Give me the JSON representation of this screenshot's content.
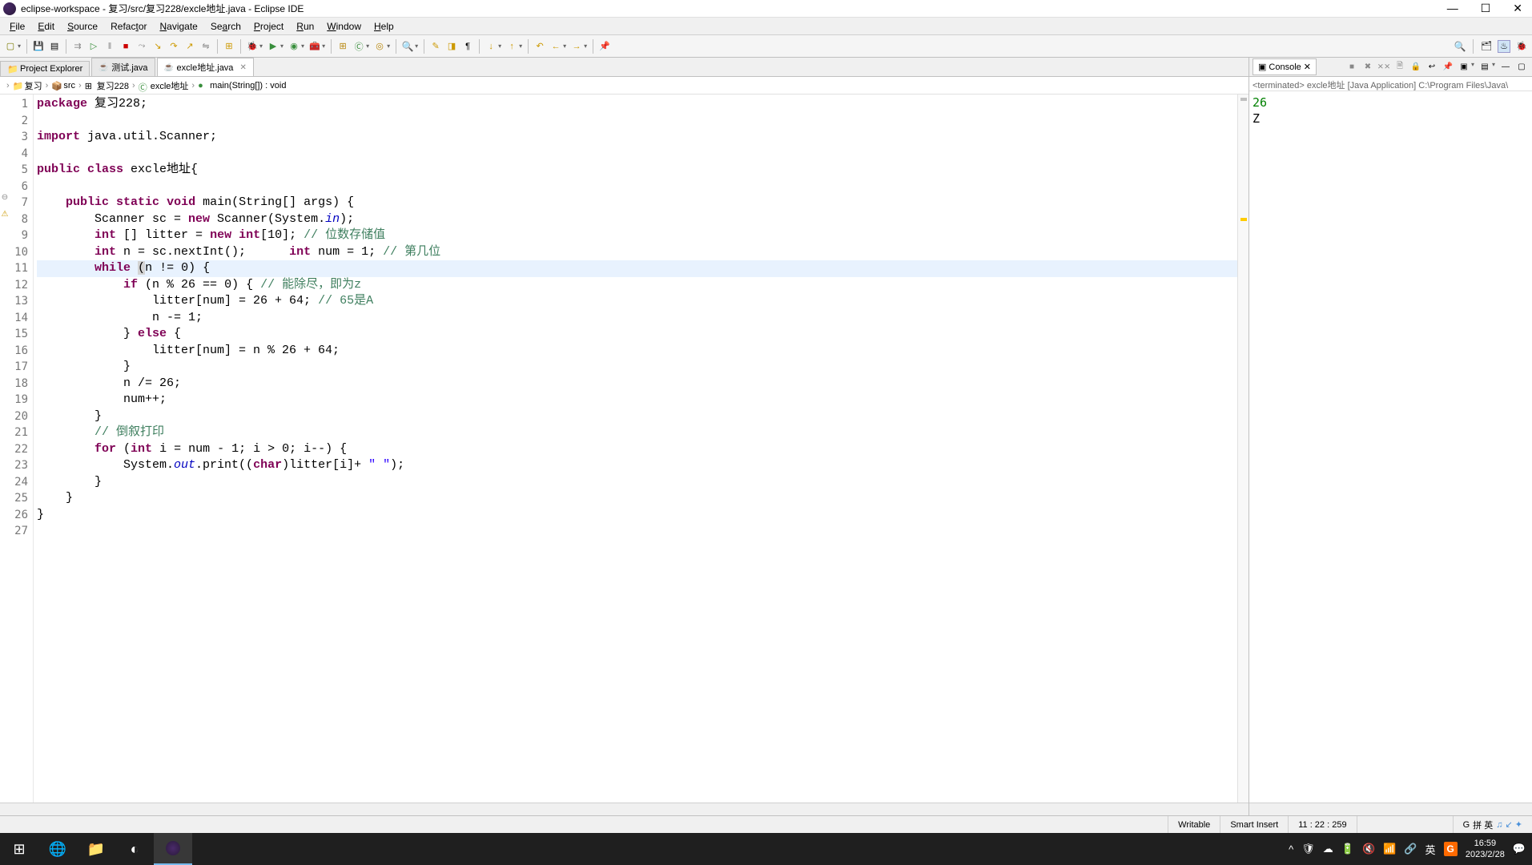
{
  "window": {
    "title": "eclipse-workspace - 复习/src/复习228/excle地址.java - Eclipse IDE"
  },
  "menu": [
    "File",
    "Edit",
    "Source",
    "Refactor",
    "Navigate",
    "Search",
    "Project",
    "Run",
    "Window",
    "Help"
  ],
  "tabs": {
    "project_explorer": "Project Explorer",
    "file1": "测试.java",
    "file2": "excle地址.java"
  },
  "breadcrumb": [
    "复习",
    "src",
    "复习228",
    "excle地址",
    "main(String[]) : void"
  ],
  "code": {
    "lines": [
      {
        "n": "1",
        "html": "<span class='kw'>package</span> 复习228;"
      },
      {
        "n": "2",
        "html": ""
      },
      {
        "n": "3",
        "html": "<span class='kw'>import</span> java.util.Scanner;"
      },
      {
        "n": "4",
        "html": ""
      },
      {
        "n": "5",
        "html": "<span class='kw'>public</span> <span class='kw'>class</span> excle地址{"
      },
      {
        "n": "6",
        "html": ""
      },
      {
        "n": "7",
        "marker": "⊖",
        "html": "    <span class='kw'>public</span> <span class='kw'>static</span> <span class='kw'>void</span> main(String[] args) {"
      },
      {
        "n": "8",
        "warn": true,
        "html": "        Scanner sc = <span class='kw'>new</span> Scanner(System.<span class='fld'>in</span>);"
      },
      {
        "n": "9",
        "html": "        <span class='kw'>int</span> [] litter = <span class='kw'>new</span> <span class='kw'>int</span>[10]; <span class='cm'>// 位数存储值</span>"
      },
      {
        "n": "10",
        "html": "        <span class='kw'>int</span> n = sc.nextInt();      <span class='kw'>int</span> num = 1; <span class='cm'>// 第几位</span>"
      },
      {
        "n": "11",
        "hl": true,
        "html": "        <span class='kw'>while</span> <span style='background:#d4d4d4'>(</span>n != 0) {"
      },
      {
        "n": "12",
        "html": "            <span class='kw'>if</span> (n % 26 == 0) { <span class='cm'>// 能除尽，即为z</span>"
      },
      {
        "n": "13",
        "html": "                litter[num] = 26 + 64; <span class='cm'>// 65是A</span>"
      },
      {
        "n": "14",
        "html": "                n -= 1;"
      },
      {
        "n": "15",
        "html": "            } <span class='kw'>else</span> {"
      },
      {
        "n": "16",
        "html": "                litter[num] = n % 26 + 64;"
      },
      {
        "n": "17",
        "html": "            }"
      },
      {
        "n": "18",
        "html": "            n /= 26;"
      },
      {
        "n": "19",
        "html": "            num++;"
      },
      {
        "n": "20",
        "html": "        }"
      },
      {
        "n": "21",
        "html": "        <span class='cm'>// 倒叙打印</span>"
      },
      {
        "n": "22",
        "html": "        <span class='kw'>for</span> (<span class='kw'>int</span> i = num - 1; i &gt; 0; i--) {"
      },
      {
        "n": "23",
        "html": "            System.<span class='fld'>out</span>.print((<span class='kw'>char</span>)litter[i]+ <span class='st'>\" \"</span>);"
      },
      {
        "n": "24",
        "html": "        }"
      },
      {
        "n": "25",
        "html": "    }"
      },
      {
        "n": "26",
        "html": "}"
      },
      {
        "n": "27",
        "html": ""
      }
    ]
  },
  "console": {
    "title": "Console",
    "status": "<terminated> excle地址 [Java Application] C:\\Program Files\\Java\\",
    "output": [
      "26",
      "Z "
    ]
  },
  "status_bar": {
    "writable": "Writable",
    "insert_mode": "Smart Insert",
    "cursor": "11 : 22 : 259"
  },
  "ime": {
    "badge": "G",
    "label": "拼 英",
    "icons": "♫ ↙ ✦"
  },
  "taskbar": {
    "time": "16:59",
    "date": "2023/2/28",
    "ime_lang": "英"
  }
}
